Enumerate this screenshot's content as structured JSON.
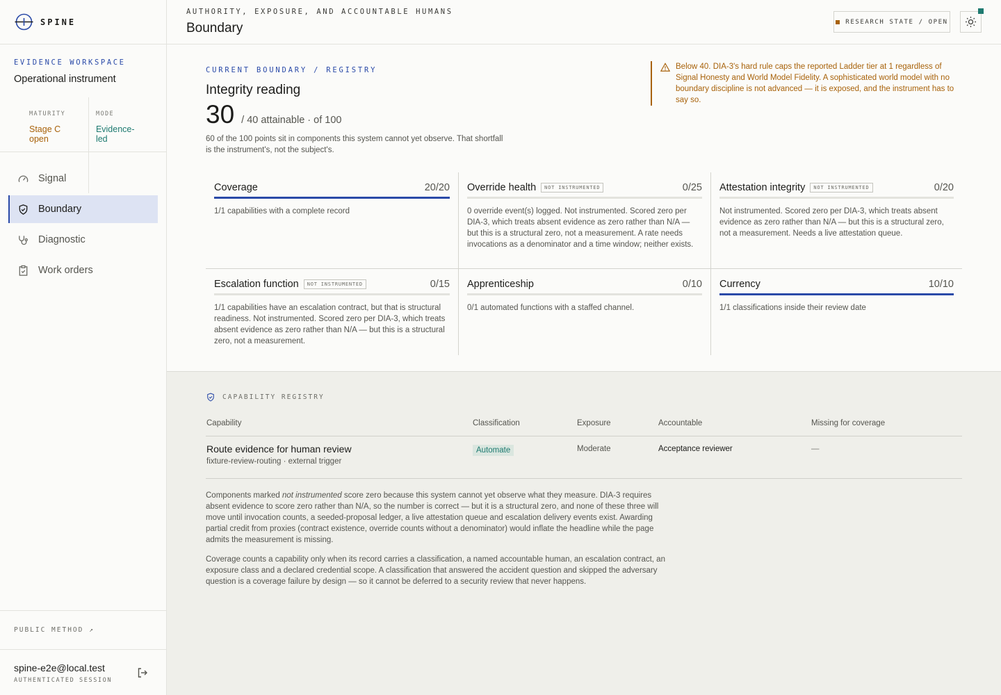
{
  "brand": {
    "name": "SPINE"
  },
  "workspace": {
    "kicker": "EVIDENCE WORKSPACE",
    "title": "Operational instrument",
    "maturity_label": "MATURITY",
    "maturity_value": "Stage C open",
    "mode_label": "MODE",
    "mode_value": "Evidence-led"
  },
  "nav": [
    {
      "label": "Signal",
      "icon": "gauge-icon"
    },
    {
      "label": "Boundary",
      "icon": "shield-check-icon",
      "active": true
    },
    {
      "label": "Diagnostic",
      "icon": "stethoscope-icon"
    },
    {
      "label": "Work orders",
      "icon": "clipboard-check-icon"
    }
  ],
  "sidebar_footer": {
    "public_method": "PUBLIC METHOD ↗",
    "email": "spine-e2e@local.test",
    "session": "AUTHENTICATED SESSION"
  },
  "header": {
    "kicker": "AUTHORITY, EXPOSURE, AND ACCOUNTABLE HUMANS",
    "title": "Boundary",
    "research_state": "RESEARCH STATE / OPEN",
    "theme_icon": "sun-icon",
    "status_color": "#1e7a70"
  },
  "integrity": {
    "kicker": "CURRENT BOUNDARY / REGISTRY",
    "title": "Integrity reading",
    "score": "30",
    "score_suffix": "/ 40 attainable · of 100",
    "shortfall": "60 of the 100 points sit in components this system cannot yet observe. That shortfall is the instrument's, not the subject's.",
    "warning": "Below 40. DIA-3's hard rule caps the reported Ladder tier at 1 regardless of Signal Honesty and World Model Fidelity. A sophisticated world model with no boundary discipline is not advanced — it is exposed, and the instrument has to say so.",
    "warning_color": "#a8620a",
    "accent_color": "#2a4aa8"
  },
  "components": [
    {
      "name": "Coverage",
      "tag": "",
      "score": "20/20",
      "fraction": 1.0,
      "desc": "1/1 capabilities with a complete record"
    },
    {
      "name": "Override health",
      "tag": "NOT INSTRUMENTED",
      "score": "0/25",
      "fraction": 0,
      "desc": "0 override event(s) logged. Not instrumented. Scored zero per DIA-3, which treats absent evidence as zero rather than N/A — but this is a structural zero, not a measurement. A rate needs invocations as a denominator and a time window; neither exists."
    },
    {
      "name": "Attestation integrity",
      "tag": "NOT INSTRUMENTED",
      "score": "0/20",
      "fraction": 0,
      "desc": "Not instrumented. Scored zero per DIA-3, which treats absent evidence as zero rather than N/A — but this is a structural zero, not a measurement. Needs a live attestation queue."
    },
    {
      "name": "Escalation function",
      "tag": "NOT INSTRUMENTED",
      "score": "0/15",
      "fraction": 0,
      "desc": "1/1 capabilities have an escalation contract, but that is structural readiness. Not instrumented. Scored zero per DIA-3, which treats absent evidence as zero rather than N/A — but this is a structural zero, not a measurement."
    },
    {
      "name": "Apprenticeship",
      "tag": "",
      "score": "0/10",
      "fraction": 0,
      "desc": "0/1 automated functions with a staffed channel."
    },
    {
      "name": "Currency",
      "tag": "",
      "score": "10/10",
      "fraction": 1.0,
      "desc": "1/1 classifications inside their review date"
    }
  ],
  "registry": {
    "kicker": "CAPABILITY REGISTRY",
    "columns": [
      "Capability",
      "Classification",
      "Exposure",
      "Accountable",
      "Missing for coverage"
    ],
    "rows": [
      {
        "capability": "Route evidence for human review",
        "sub": "fixture-review-routing · external trigger",
        "classification": "Automate",
        "exposure": "Moderate",
        "accountable": "Acceptance reviewer",
        "missing": "—"
      }
    ],
    "note1_pre": "Components marked ",
    "note1_em": "not instrumented",
    "note1_post": " score zero because this system cannot yet observe what they measure. DIA-3 requires absent evidence to score zero rather than N/A, so the number is correct — but it is a structural zero, and none of these three will move until invocation counts, a seeded-proposal ledger, a live attestation queue and escalation delivery events exist. Awarding partial credit from proxies (contract existence, override counts without a denominator) would inflate the headline while the page admits the measurement is missing.",
    "note2": "Coverage counts a capability only when its record carries a classification, a named accountable human, an escalation contract, an exposure class and a declared credential scope. A classification that answered the accident question and skipped the adversary question is a coverage failure by design — so it cannot be deferred to a security review that never happens."
  }
}
